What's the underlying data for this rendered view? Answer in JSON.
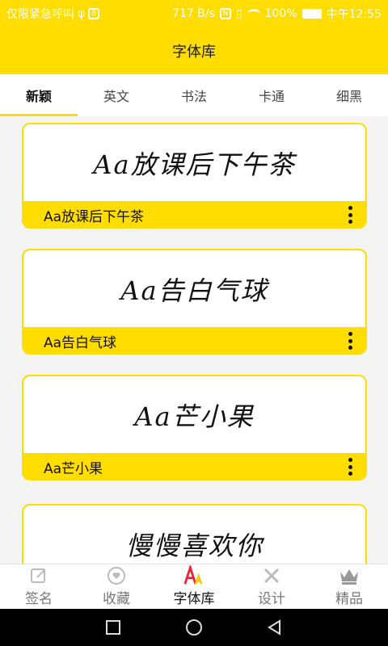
{
  "status_bar": {
    "left_text": "仅限紧急呼叫",
    "speed": "717 B/s",
    "battery": "100%",
    "time": "中午12:55"
  },
  "header": {
    "title": "字体库"
  },
  "tabs": [
    {
      "label": "新颖",
      "active": true
    },
    {
      "label": "英文",
      "active": false
    },
    {
      "label": "书法",
      "active": false
    },
    {
      "label": "卡通",
      "active": false
    },
    {
      "label": "细黑",
      "active": false
    }
  ],
  "fonts": [
    {
      "preview": "Aa放课后下午茶",
      "name": "Aa放课后下午茶"
    },
    {
      "preview": "Aa告白气球",
      "name": "Aa告白气球"
    },
    {
      "preview": "Aa芒小果",
      "name": "Aa芒小果"
    },
    {
      "preview": "慢慢喜欢你",
      "name": ""
    }
  ],
  "bottom_nav": [
    {
      "label": "签名",
      "icon": "edit-icon",
      "active": false
    },
    {
      "label": "收藏",
      "icon": "heart-icon",
      "active": false
    },
    {
      "label": "字体库",
      "icon": "font-icon",
      "active": true
    },
    {
      "label": "设计",
      "icon": "design-icon",
      "active": false
    },
    {
      "label": "精品",
      "icon": "crown-icon",
      "active": false
    }
  ],
  "colors": {
    "accent": "#ffdd00",
    "font_icon_red": "#e8243c",
    "font_icon_yellow": "#ffc400"
  }
}
